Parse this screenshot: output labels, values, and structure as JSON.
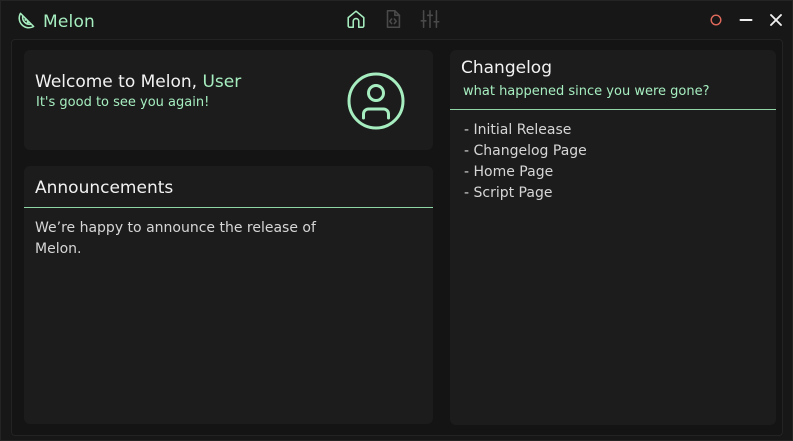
{
  "app": {
    "name": "Melon"
  },
  "nav": [
    {
      "icon": "home-icon",
      "active": true
    },
    {
      "icon": "script-file-icon",
      "active": false
    },
    {
      "icon": "sliders-icon",
      "active": false
    }
  ],
  "window_controls": {
    "status_color": "#e06a5c"
  },
  "welcome": {
    "greeting": "Welcome to Melon,",
    "user": "User",
    "subtitle": "It's good to see you again!"
  },
  "announcements": {
    "title": "Announcements",
    "body": "We’re happy to announce the release of Melon."
  },
  "changelog": {
    "title": "Changelog",
    "subtitle": "what happened since you were gone?",
    "items": [
      "- Initial Release",
      "- Changelog Page",
      "- Home Page",
      "- Script Page"
    ]
  },
  "colors": {
    "accent": "#a6eec0",
    "background": "#171717",
    "card": "#1c1c1c"
  }
}
